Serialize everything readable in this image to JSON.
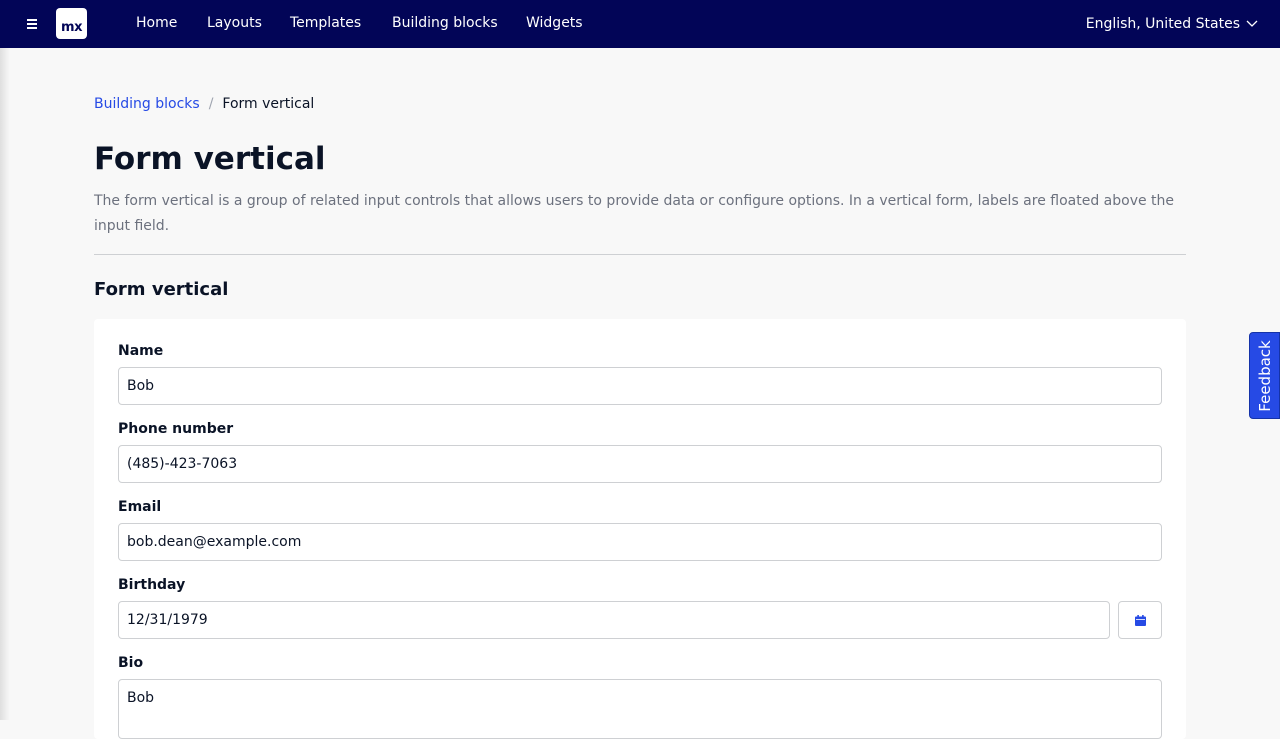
{
  "header": {
    "logo_text": "mx",
    "nav": [
      "Home",
      "Layouts",
      "Templates",
      "Building blocks",
      "Widgets"
    ],
    "language": "English, United States"
  },
  "breadcrumb": {
    "parent": "Building blocks",
    "separator": "/",
    "current": "Form vertical"
  },
  "page": {
    "title": "Form vertical",
    "description": "The form vertical is a group of related input controls that allows users to provide data or configure options. In a vertical form, labels are floated above the input field.",
    "section_title": "Form vertical"
  },
  "form": {
    "name": {
      "label": "Name",
      "value": "Bob"
    },
    "phone": {
      "label": "Phone number",
      "value": "(485)-423-7063"
    },
    "email": {
      "label": "Email",
      "value": "bob.dean@example.com"
    },
    "birthday": {
      "label": "Birthday",
      "value": "12/31/1979"
    },
    "bio": {
      "label": "Bio",
      "value": "Bob"
    }
  },
  "feedback": {
    "label": "Feedback"
  },
  "icons": {
    "menu": "menu-icon",
    "chevron": "chevron-down-icon",
    "calendar": "calendar-icon"
  },
  "colors": {
    "topbar": "#020557",
    "accent": "#264ae5",
    "page_bg": "#f8f8f8"
  }
}
